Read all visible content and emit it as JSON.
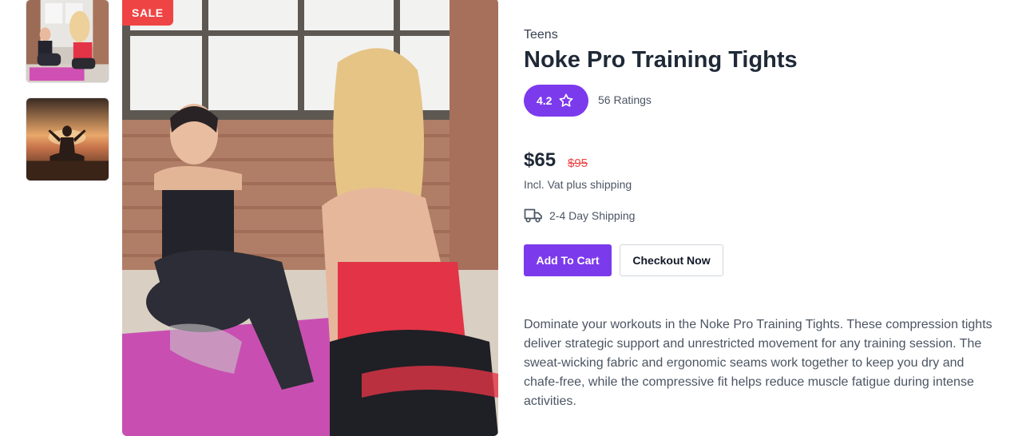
{
  "product": {
    "sale_badge": "SALE",
    "category": "Teens",
    "title": "Noke Pro Training Tights",
    "rating": "4.2",
    "ratings_count": "56 Ratings",
    "price": "$65",
    "old_price": "$95",
    "vat_note": "Incl. Vat plus shipping",
    "shipping": "2-4 Day Shipping",
    "description": "Dominate your workouts in the Noke Pro Training Tights. These compression tights deliver strategic support and unrestricted movement for any training session. The sweat-wicking fabric and ergonomic seams work together to keep you dry and chafe-free, while the compressive fit helps reduce muscle fatigue during intense activities."
  },
  "actions": {
    "add_to_cart": "Add To Cart",
    "checkout": "Checkout Now"
  },
  "icons": {
    "rating": "star-icon",
    "shipping": "truck-icon"
  },
  "colors": {
    "accent": "#7c3aed",
    "sale": "#ef4444",
    "price_old": "#ef4444"
  }
}
